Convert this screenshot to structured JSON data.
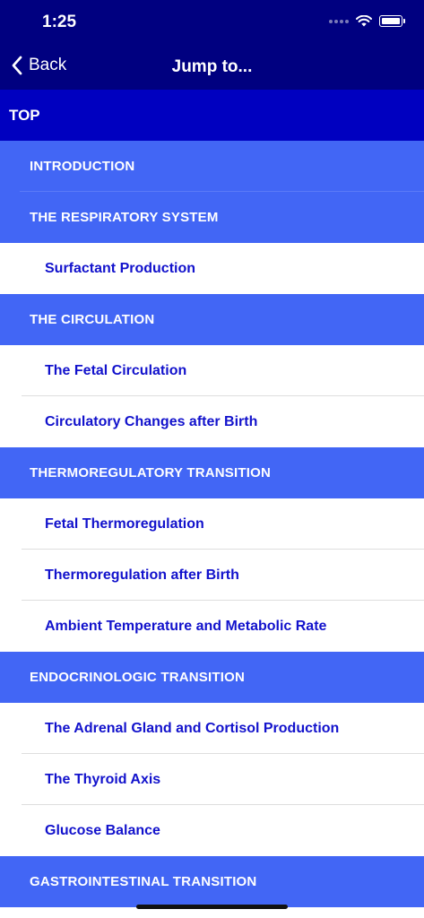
{
  "status": {
    "time": "1:25"
  },
  "nav": {
    "back_label": "Back",
    "title": "Jump to..."
  },
  "rows": [
    {
      "kind": "top",
      "label": "TOP"
    },
    {
      "kind": "section",
      "label": "INTRODUCTION"
    },
    {
      "kind": "section",
      "label": "THE RESPIRATORY SYSTEM"
    },
    {
      "kind": "item",
      "label": "Surfactant Production"
    },
    {
      "kind": "section",
      "label": "THE CIRCULATION"
    },
    {
      "kind": "item",
      "label": "The Fetal Circulation"
    },
    {
      "kind": "item",
      "label": "Circulatory Changes after Birth"
    },
    {
      "kind": "section",
      "label": "THERMOREGULATORY TRANSITION"
    },
    {
      "kind": "item",
      "label": "Fetal Thermoregulation"
    },
    {
      "kind": "item",
      "label": "Thermoregulation after Birth"
    },
    {
      "kind": "item",
      "label": "Ambient Temperature and Metabolic Rate"
    },
    {
      "kind": "section",
      "label": "ENDOCRINOLOGIC TRANSITION"
    },
    {
      "kind": "item",
      "label": "The Adrenal Gland and Cortisol Production"
    },
    {
      "kind": "item",
      "label": "The Thyroid Axis"
    },
    {
      "kind": "item",
      "label": "Glucose Balance"
    },
    {
      "kind": "section",
      "label": "GASTROINTESTINAL TRANSITION"
    }
  ],
  "colors": {
    "nav_background": "#000080",
    "top_row": "#0000c0",
    "section_row": "#4266f5",
    "item_text": "#1212cc"
  }
}
